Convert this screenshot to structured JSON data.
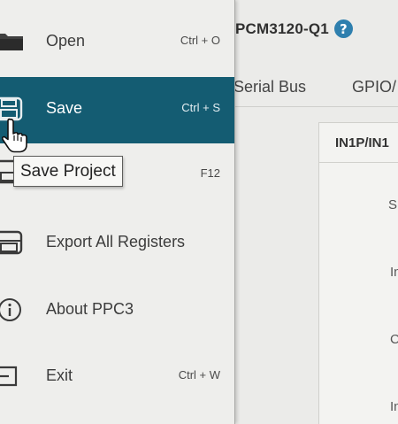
{
  "app": {
    "device_title": "PCM3120-Q1",
    "tabs": [
      {
        "label": "Serial Bus"
      },
      {
        "label": "GPIO/"
      }
    ],
    "panel": {
      "header": "IN1P/IN1",
      "rows": [
        "S",
        "In",
        "C",
        "In"
      ]
    }
  },
  "menu": {
    "items": [
      {
        "label": "Open",
        "shortcut": "Ctrl + O",
        "icon": "folder-icon"
      },
      {
        "label": "Save",
        "shortcut": "Ctrl + S",
        "icon": "save-icon",
        "selected": true
      },
      {
        "label": "",
        "shortcut": "F12",
        "icon": "save-as-icon"
      },
      {
        "label": "Export All Registers",
        "shortcut": "",
        "icon": "export-icon"
      },
      {
        "label": "About PPC3",
        "shortcut": "",
        "icon": "info-icon"
      },
      {
        "label": "Exit",
        "shortcut": "Ctrl + W",
        "icon": "exit-icon"
      }
    ]
  },
  "tooltip": {
    "text": "Save Project"
  },
  "colors": {
    "selected_bg": "#145c72",
    "menu_bg": "#eeeeec",
    "help_icon": "#2e7fae"
  }
}
